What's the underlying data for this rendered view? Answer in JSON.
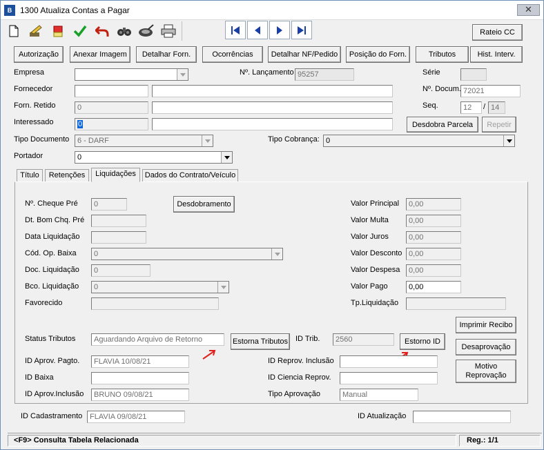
{
  "window": {
    "title": "1300 Atualiza Contas a Pagar",
    "close": "✕"
  },
  "toolbar": {
    "rateio_label": "Rateio CC"
  },
  "actions": [
    "Autorização",
    "Anexar Imagem",
    "Detalhar Forn.",
    "Ocorrências",
    "Detalhar NF/Pedido",
    "Posição do Forn.",
    "Tributos",
    "Hist. Interv."
  ],
  "header": {
    "empresa_label": "Empresa",
    "lancamento_label": "Nº. Lançamento",
    "lancamento_value": "95257",
    "serie_label": "Série",
    "fornecedor_label": "Fornecedor",
    "documento_label": "Nº. Docum.",
    "documento_value": "72021",
    "forn_retido_label": "Forn. Retido",
    "forn_retido_value": "0",
    "seq_label": "Seq.",
    "seq_value": "12",
    "seq_sep": "/",
    "seq_total": "14",
    "interessado_label": "Interessado",
    "interessado_value": "0",
    "desdobra_label": "Desdobra Parcela",
    "repetir_label": "Repetir",
    "tipo_doc_label": "Tipo Documento",
    "tipo_doc_value": "6 - DARF",
    "tipo_cobranca_label": "Tipo Cobrança:",
    "tipo_cobranca_value": "0",
    "portador_label": "Portador",
    "portador_value": "0"
  },
  "tabs": [
    "Título",
    "Retenções",
    "Liquidações",
    "Dados do Contrato/Veículo"
  ],
  "liquidacoes": {
    "cheque_label": "Nº. Cheque Pré",
    "cheque_value": "0",
    "desdobramento_label": "Desdobramento",
    "bom_chq_label": "Dt. Bom Chq. Pré",
    "data_liq_label": "Data Liquidação",
    "cod_op_label": "Cód. Op. Baixa",
    "cod_op_value": "0",
    "doc_liq_label": "Doc. Liquidação",
    "doc_liq_value": "0",
    "bco_liq_label": "Bco. Liquidação",
    "bco_liq_value": "0",
    "favorecido_label": "Favorecido",
    "valor_principal_label": "Valor Principal",
    "valor_principal": "0,00",
    "valor_multa_label": "Valor Multa",
    "valor_multa": "0,00",
    "valor_juros_label": "Valor Juros",
    "valor_juros": "0,00",
    "valor_desconto_label": "Valor Desconto",
    "valor_desconto": "0,00",
    "valor_despesa_label": "Valor Despesa",
    "valor_despesa": "0,00",
    "valor_pago_label": "Valor Pago",
    "valor_pago": "0,00",
    "tp_liq_label": "Tp.Liquidação",
    "imprimir_label": "Imprimir Recibo",
    "status_label": "Status Tributos",
    "status_value": "Aguardando Arquivo de Retorno",
    "estorna_label": "Estorna Tributos",
    "id_trib_label": "ID Trib.",
    "id_trib_value": "2560",
    "estorno_id_label": "Estorno ID",
    "desaprovacao_label": "Desaprovação",
    "aprov_pagto_label": "ID Aprov. Pagto.",
    "aprov_pagto_value": "FLAVIA 10/08/21",
    "reprov_inclusao_label": "ID Reprov. Inclusão",
    "motivo_label_1": "Motivo",
    "motivo_label_2": "Reprovação",
    "baixa_label": "ID Baixa",
    "ciencia_label": "ID Ciencia Reprov.",
    "aprov_inclusao_label": "ID Aprov.Inclusão",
    "aprov_inclusao_value": "BRUNO 09/08/21",
    "tipo_aprov_label": "Tipo Aprovação",
    "tipo_aprov_value": "Manual"
  },
  "footer": {
    "cadastramento_label": "ID Cadastramento",
    "cadastramento_value": "FLAVIA 09/08/21",
    "atualizacao_label": "ID Atualização"
  },
  "statusbar": {
    "hint": "<F9> Consulta Tabela Relacionada",
    "reg": "Reg.: 1/1"
  },
  "colors": {
    "arrow": "#e0201c",
    "title_icon": "#1c4f9c"
  }
}
